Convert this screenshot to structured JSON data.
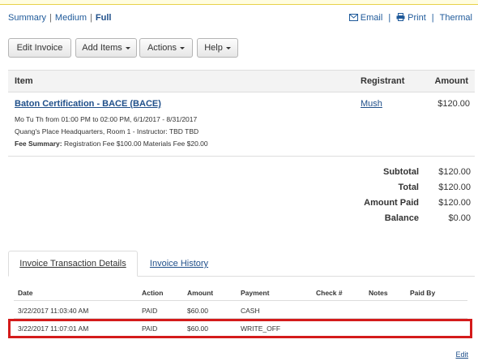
{
  "views": {
    "summary": "Summary",
    "medium": "Medium",
    "full": "Full",
    "sep": "|"
  },
  "utilities": {
    "email": "Email",
    "print": "Print",
    "thermal": "Thermal",
    "sep": "|"
  },
  "toolbar": {
    "edit_invoice": "Edit Invoice",
    "add_items": "Add Items",
    "actions": "Actions",
    "help": "Help"
  },
  "item_table": {
    "headers": {
      "item": "Item",
      "registrant": "Registrant",
      "amount": "Amount"
    },
    "row": {
      "title": "Baton Certification - BACE  (BACE)",
      "schedule": "Mo Tu Th from 01:00 PM to 02:00 PM,  6/1/2017 - 8/31/2017",
      "location": "Quang's Place Headquarters, Room 1 - Instructor: TBD TBD",
      "fee_label": "Fee Summary:",
      "fee_text": "Registration Fee $100.00  Materials Fee $20.00",
      "registrant": "Mush",
      "amount": "$120.00"
    }
  },
  "totals": [
    {
      "label": "Subtotal",
      "value": "$120.00"
    },
    {
      "label": "Total",
      "value": "$120.00"
    },
    {
      "label": "Amount Paid",
      "value": "$120.00"
    },
    {
      "label": "Balance",
      "value": "$0.00"
    }
  ],
  "tabs": {
    "transactions": "Invoice Transaction Details",
    "history": "Invoice History",
    "active": "transactions"
  },
  "transactions": {
    "headers": [
      "Date",
      "Action",
      "Amount",
      "Payment",
      "Check #",
      "Notes",
      "Paid By"
    ],
    "rows": [
      {
        "date": "3/22/2017 11:03:40 AM",
        "action": "PAID",
        "amount": "$60.00",
        "payment": "CASH"
      },
      {
        "date": "3/22/2017 11:07:01 AM",
        "action": "PAID",
        "amount": "$60.00",
        "payment": "WRITE_OFF"
      }
    ]
  },
  "edit_link": "Edit",
  "colors": {
    "link": "#1f4f8a",
    "highlight": "#d41b1b"
  },
  "icons": {
    "email": "envelope-icon",
    "print": "printer-icon",
    "caret": "caret-down-icon"
  }
}
